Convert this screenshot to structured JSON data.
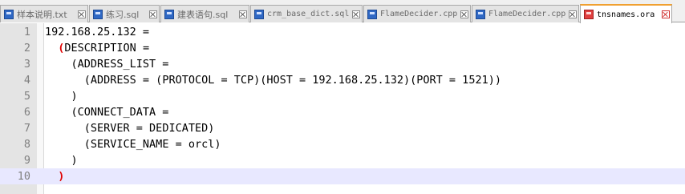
{
  "tabs": [
    {
      "label": "样本说明.txt",
      "active": false,
      "icon": "file-icon"
    },
    {
      "label": "练习.sql",
      "active": false,
      "icon": "file-icon"
    },
    {
      "label": "建表语句.sql",
      "active": false,
      "icon": "file-icon"
    },
    {
      "label": "crm_base_dict.sql",
      "active": false,
      "icon": "file-icon"
    },
    {
      "label": "FlameDecider.cpp",
      "active": false,
      "icon": "file-icon"
    },
    {
      "label": "FlameDecider.cpp",
      "active": false,
      "icon": "file-icon"
    },
    {
      "label": "tnsnames.ora",
      "active": true,
      "icon": "file-icon-modified"
    }
  ],
  "editor": {
    "current_line": 10,
    "brace_highlight_color": "#e00000",
    "current_line_color": "#e8e8ff",
    "lines": [
      {
        "num": "1",
        "indent": "",
        "open": "",
        "text": "192.168.25.132 ="
      },
      {
        "num": "2",
        "indent": "  ",
        "open": "(",
        "text": "DESCRIPTION ="
      },
      {
        "num": "3",
        "indent": "    ",
        "open": "",
        "text": "(ADDRESS_LIST ="
      },
      {
        "num": "4",
        "indent": "      ",
        "open": "",
        "text": "(ADDRESS = (PROTOCOL = TCP)(HOST = 192.168.25.132)(PORT = 1521))"
      },
      {
        "num": "5",
        "indent": "    ",
        "open": "",
        "text": ")"
      },
      {
        "num": "6",
        "indent": "    ",
        "open": "",
        "text": "(CONNECT_DATA ="
      },
      {
        "num": "7",
        "indent": "      ",
        "open": "",
        "text": "(SERVER = DEDICATED)"
      },
      {
        "num": "8",
        "indent": "      ",
        "open": "",
        "text": "(SERVICE_NAME = orcl)"
      },
      {
        "num": "9",
        "indent": "    ",
        "open": "",
        "text": ")"
      },
      {
        "num": "10",
        "indent": "  ",
        "open": ")",
        "text": ""
      }
    ]
  }
}
